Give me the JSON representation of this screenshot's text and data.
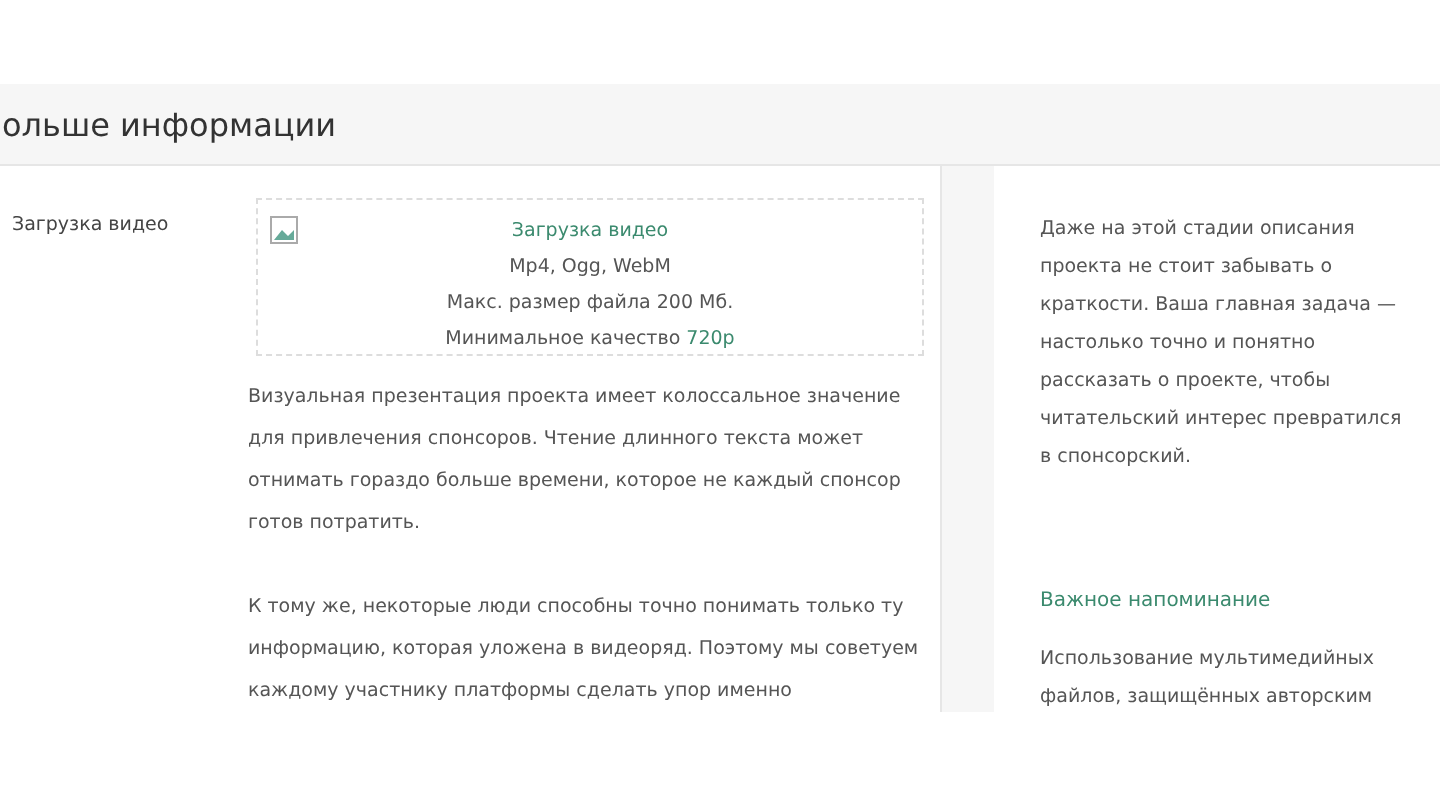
{
  "header": {
    "title": "ольше информации"
  },
  "field": {
    "label": "Загрузка видео"
  },
  "upload": {
    "title": "Загрузка видео",
    "formats": "Mp4, Ogg, WebM",
    "max_size": "Макс. размер файла 200 Мб.",
    "quality_label": "Минимальное качество",
    "quality_value": "720p"
  },
  "description": [
    "Визуальная презентация проекта имеет колоссальное значение для привлечения спонсоров. Чтение длинного текста может отнимать гораздо больше времени, которое не каждый спонсор готов потратить.",
    "К тому же, некоторые люди способны точно понимать только ту информацию, которая уложена в видеоряд. Поэтому мы советуем каждому участнику платформы сделать упор именно"
  ],
  "sidebar": {
    "tip": "Даже на этой стадии описания проекта не стоит забывать о краткости. Ваша главная задача — настолько точно и понятно рассказать о проекте, чтобы читательский интерес превратился в спонсорский.",
    "reminder_title": "Важное напоминание",
    "reminder_text": "Использование мультимедийных файлов, защищённых авторским"
  }
}
